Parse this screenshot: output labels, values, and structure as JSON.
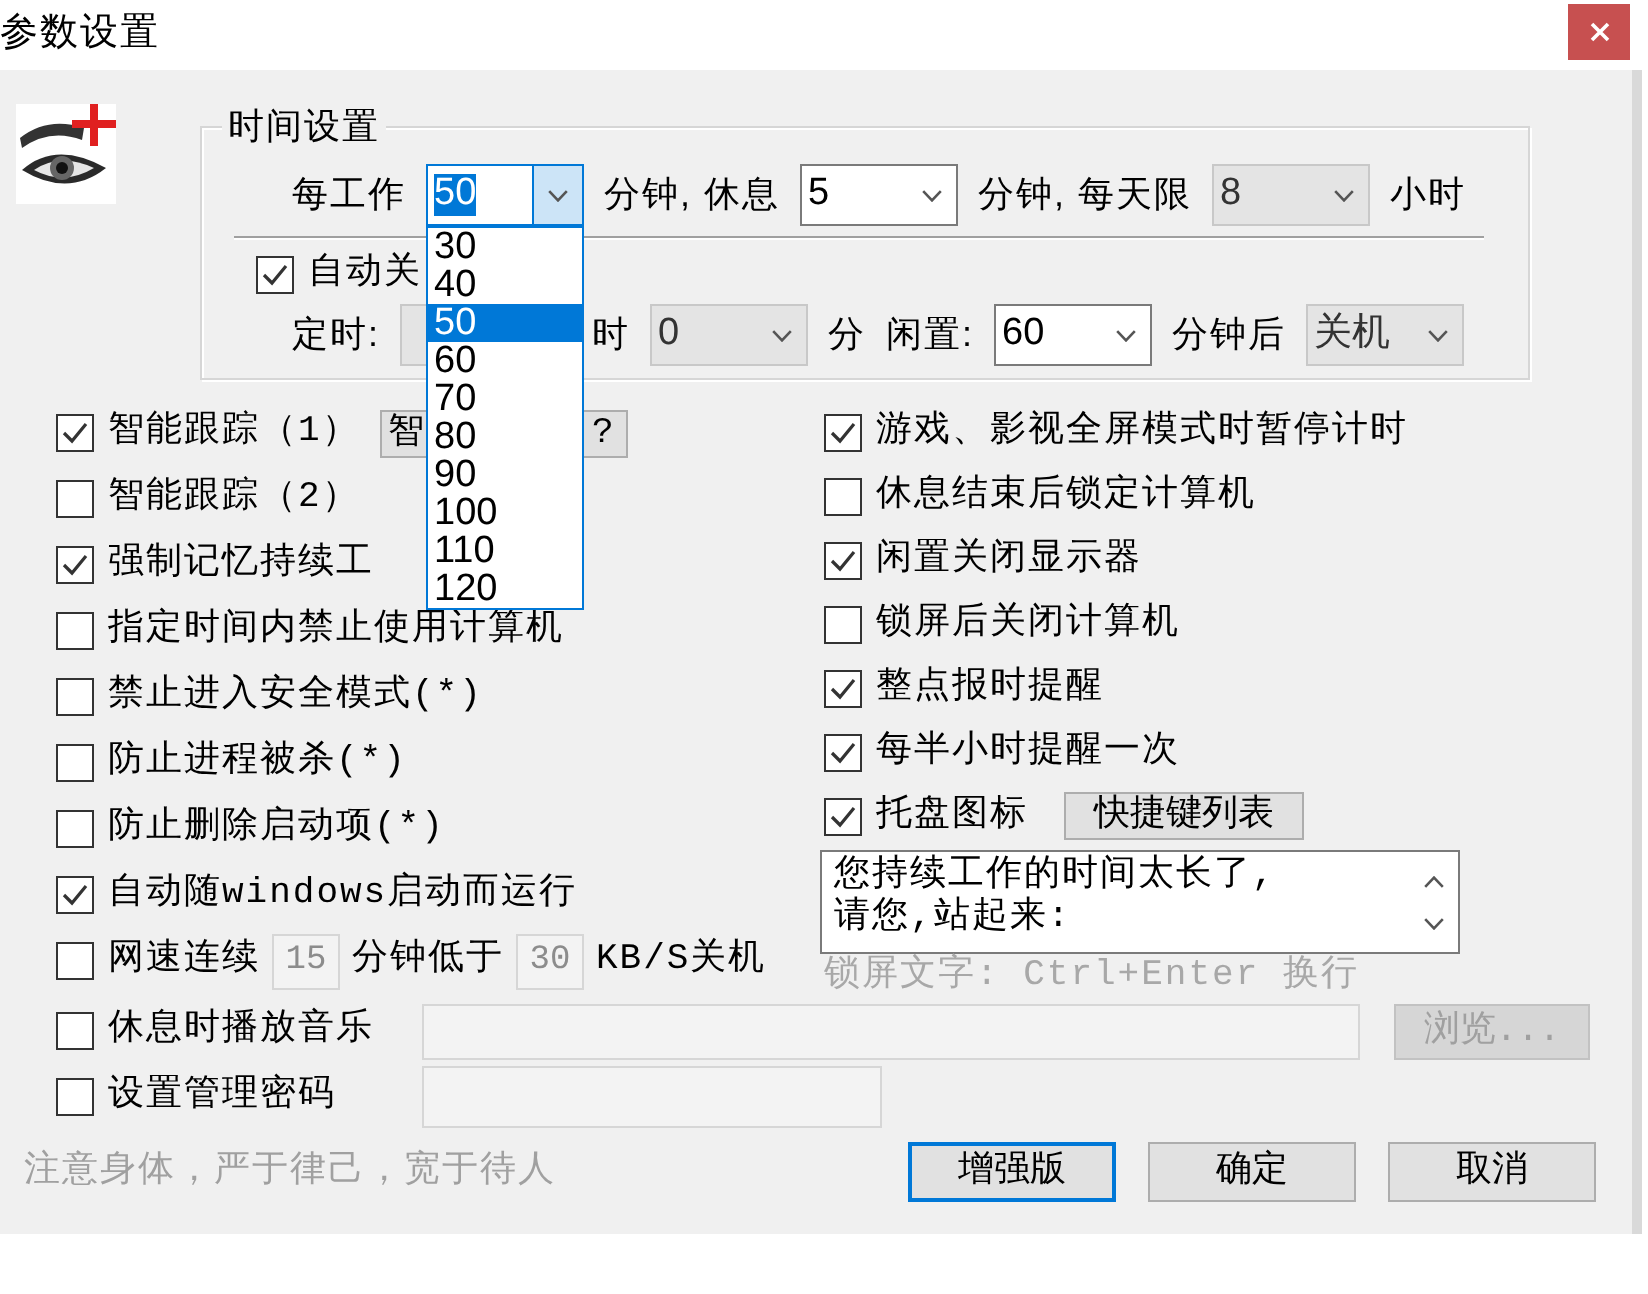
{
  "window": {
    "title": "参数设置"
  },
  "time_settings": {
    "title": "时间设置",
    "rows": [
      {
        "items": [
          {
            "kind": "text",
            "text": "每工作"
          },
          {
            "kind": "combo",
            "value": "50",
            "disabled": false,
            "expanded": true,
            "options": [
              {
                "label": "30",
                "selected": false
              },
              {
                "label": "40",
                "selected": false
              },
              {
                "label": "50",
                "selected": true
              },
              {
                "label": "60",
                "selected": false
              },
              {
                "label": "70",
                "selected": false
              },
              {
                "label": "80",
                "selected": false
              },
              {
                "label": "90",
                "selected": false
              },
              {
                "label": "100",
                "selected": false
              },
              {
                "label": "110",
                "selected": false
              },
              {
                "label": "120",
                "selected": false
              }
            ]
          },
          {
            "kind": "text",
            "text": "分钟, 休息"
          },
          {
            "kind": "combo",
            "value": "5",
            "disabled": false,
            "expanded": false
          },
          {
            "kind": "text",
            "text": "分钟, 每天限"
          },
          {
            "kind": "combo",
            "value": "8",
            "disabled": true,
            "expanded": false
          },
          {
            "kind": "text",
            "text": "小时"
          }
        ]
      },
      {
        "items": [
          {
            "kind": "checkbox",
            "label": "自动关",
            "checked": true
          }
        ]
      },
      {
        "items": [
          {
            "kind": "text",
            "text": "定时:"
          },
          {
            "kind": "field",
            "disabled": true
          },
          {
            "kind": "text",
            "text": "时"
          },
          {
            "kind": "combo",
            "value": "0",
            "disabled": true,
            "expanded": false
          },
          {
            "kind": "text",
            "text": "分"
          },
          {
            "kind": "text",
            "text": "闲置:"
          },
          {
            "kind": "combo",
            "value": "60",
            "disabled": false,
            "expanded": false
          },
          {
            "kind": "text",
            "text": "分钟后"
          },
          {
            "kind": "combo",
            "value": "关机",
            "disabled": true,
            "expanded": false
          }
        ]
      }
    ]
  },
  "left_options": [
    {
      "label": "智能跟踪（1）",
      "checked": true,
      "extras": [
        {
          "kind": "button",
          "label_start": "智",
          "label_end": "?",
          "disabled": false
        }
      ]
    },
    {
      "label": "智能跟踪（2）",
      "checked": false
    },
    {
      "label": "强制记忆持续工",
      "checked": true
    },
    {
      "label": "指定时间内禁止使用计算机",
      "checked": false
    },
    {
      "label": "禁止进入安全模式(*)",
      "checked": false
    },
    {
      "label": "防止进程被杀(*)",
      "checked": false
    },
    {
      "label": "防止删除启动项(*)",
      "checked": false
    },
    {
      "label": "自动随windows启动而运行",
      "checked": true
    },
    {
      "label": "网速连续",
      "checked": false,
      "extras": [
        {
          "kind": "field",
          "value": "15",
          "disabled": true
        },
        {
          "kind": "text",
          "text": "分钟低于"
        },
        {
          "kind": "field",
          "value": "30",
          "disabled": true
        },
        {
          "kind": "text",
          "text": "KB/S关机"
        }
      ]
    }
  ],
  "right_options": [
    {
      "label": "游戏、影视全屏模式时暂停计时",
      "checked": true
    },
    {
      "label": "休息结束后锁定计算机",
      "checked": false
    },
    {
      "label": "闲置关闭显示器",
      "checked": true
    },
    {
      "label": "锁屏后关闭计算机",
      "checked": false
    },
    {
      "label": "整点报时提醒",
      "checked": true
    },
    {
      "label": "每半小时提醒一次",
      "checked": true
    },
    {
      "label": "托盘图标",
      "checked": true,
      "extras": [
        {
          "kind": "button",
          "label": "快捷键列表",
          "disabled": false
        }
      ]
    }
  ],
  "lock_text": {
    "value": "您持续工作的时间太长了,\n请您,站起来:",
    "caption": "锁屏文字: Ctrl+Enter 换行"
  },
  "bottom_options": [
    {
      "label": "休息时播放音乐",
      "checked": false,
      "extras": [
        {
          "kind": "field",
          "disabled": true
        },
        {
          "kind": "button",
          "label": "浏览...",
          "disabled": true
        }
      ]
    },
    {
      "label": "设置管理密码",
      "checked": false,
      "extras": [
        {
          "kind": "field",
          "disabled": true
        }
      ]
    }
  ],
  "footer": {
    "motto": "注意身体，严于律己，宽于待人",
    "buttons": [
      {
        "label": "增强版",
        "focused": true
      },
      {
        "label": "确定",
        "focused": false
      },
      {
        "label": "取消",
        "focused": false
      }
    ]
  }
}
